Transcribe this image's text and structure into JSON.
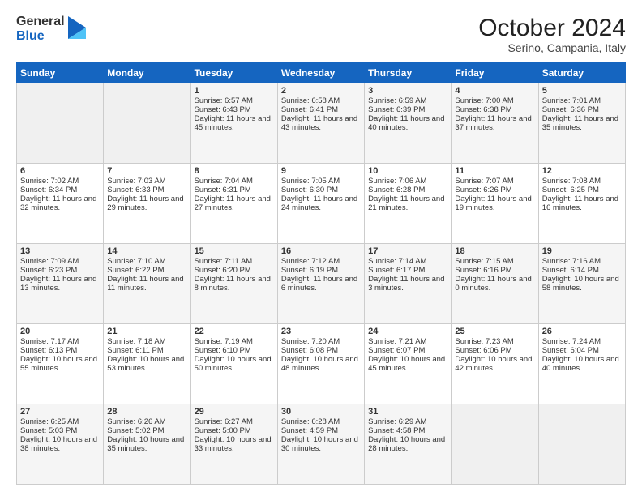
{
  "header": {
    "logo_general": "General",
    "logo_blue": "Blue",
    "title": "October 2024",
    "location": "Serino, Campania, Italy"
  },
  "days_of_week": [
    "Sunday",
    "Monday",
    "Tuesday",
    "Wednesday",
    "Thursday",
    "Friday",
    "Saturday"
  ],
  "weeks": [
    [
      {
        "day": "",
        "info": ""
      },
      {
        "day": "",
        "info": ""
      },
      {
        "day": "1",
        "info": "Sunrise: 6:57 AM\nSunset: 6:43 PM\nDaylight: 11 hours and 45 minutes."
      },
      {
        "day": "2",
        "info": "Sunrise: 6:58 AM\nSunset: 6:41 PM\nDaylight: 11 hours and 43 minutes."
      },
      {
        "day": "3",
        "info": "Sunrise: 6:59 AM\nSunset: 6:39 PM\nDaylight: 11 hours and 40 minutes."
      },
      {
        "day": "4",
        "info": "Sunrise: 7:00 AM\nSunset: 6:38 PM\nDaylight: 11 hours and 37 minutes."
      },
      {
        "day": "5",
        "info": "Sunrise: 7:01 AM\nSunset: 6:36 PM\nDaylight: 11 hours and 35 minutes."
      }
    ],
    [
      {
        "day": "6",
        "info": "Sunrise: 7:02 AM\nSunset: 6:34 PM\nDaylight: 11 hours and 32 minutes."
      },
      {
        "day": "7",
        "info": "Sunrise: 7:03 AM\nSunset: 6:33 PM\nDaylight: 11 hours and 29 minutes."
      },
      {
        "day": "8",
        "info": "Sunrise: 7:04 AM\nSunset: 6:31 PM\nDaylight: 11 hours and 27 minutes."
      },
      {
        "day": "9",
        "info": "Sunrise: 7:05 AM\nSunset: 6:30 PM\nDaylight: 11 hours and 24 minutes."
      },
      {
        "day": "10",
        "info": "Sunrise: 7:06 AM\nSunset: 6:28 PM\nDaylight: 11 hours and 21 minutes."
      },
      {
        "day": "11",
        "info": "Sunrise: 7:07 AM\nSunset: 6:26 PM\nDaylight: 11 hours and 19 minutes."
      },
      {
        "day": "12",
        "info": "Sunrise: 7:08 AM\nSunset: 6:25 PM\nDaylight: 11 hours and 16 minutes."
      }
    ],
    [
      {
        "day": "13",
        "info": "Sunrise: 7:09 AM\nSunset: 6:23 PM\nDaylight: 11 hours and 13 minutes."
      },
      {
        "day": "14",
        "info": "Sunrise: 7:10 AM\nSunset: 6:22 PM\nDaylight: 11 hours and 11 minutes."
      },
      {
        "day": "15",
        "info": "Sunrise: 7:11 AM\nSunset: 6:20 PM\nDaylight: 11 hours and 8 minutes."
      },
      {
        "day": "16",
        "info": "Sunrise: 7:12 AM\nSunset: 6:19 PM\nDaylight: 11 hours and 6 minutes."
      },
      {
        "day": "17",
        "info": "Sunrise: 7:14 AM\nSunset: 6:17 PM\nDaylight: 11 hours and 3 minutes."
      },
      {
        "day": "18",
        "info": "Sunrise: 7:15 AM\nSunset: 6:16 PM\nDaylight: 11 hours and 0 minutes."
      },
      {
        "day": "19",
        "info": "Sunrise: 7:16 AM\nSunset: 6:14 PM\nDaylight: 10 hours and 58 minutes."
      }
    ],
    [
      {
        "day": "20",
        "info": "Sunrise: 7:17 AM\nSunset: 6:13 PM\nDaylight: 10 hours and 55 minutes."
      },
      {
        "day": "21",
        "info": "Sunrise: 7:18 AM\nSunset: 6:11 PM\nDaylight: 10 hours and 53 minutes."
      },
      {
        "day": "22",
        "info": "Sunrise: 7:19 AM\nSunset: 6:10 PM\nDaylight: 10 hours and 50 minutes."
      },
      {
        "day": "23",
        "info": "Sunrise: 7:20 AM\nSunset: 6:08 PM\nDaylight: 10 hours and 48 minutes."
      },
      {
        "day": "24",
        "info": "Sunrise: 7:21 AM\nSunset: 6:07 PM\nDaylight: 10 hours and 45 minutes."
      },
      {
        "day": "25",
        "info": "Sunrise: 7:23 AM\nSunset: 6:06 PM\nDaylight: 10 hours and 42 minutes."
      },
      {
        "day": "26",
        "info": "Sunrise: 7:24 AM\nSunset: 6:04 PM\nDaylight: 10 hours and 40 minutes."
      }
    ],
    [
      {
        "day": "27",
        "info": "Sunrise: 6:25 AM\nSunset: 5:03 PM\nDaylight: 10 hours and 38 minutes."
      },
      {
        "day": "28",
        "info": "Sunrise: 6:26 AM\nSunset: 5:02 PM\nDaylight: 10 hours and 35 minutes."
      },
      {
        "day": "29",
        "info": "Sunrise: 6:27 AM\nSunset: 5:00 PM\nDaylight: 10 hours and 33 minutes."
      },
      {
        "day": "30",
        "info": "Sunrise: 6:28 AM\nSunset: 4:59 PM\nDaylight: 10 hours and 30 minutes."
      },
      {
        "day": "31",
        "info": "Sunrise: 6:29 AM\nSunset: 4:58 PM\nDaylight: 10 hours and 28 minutes."
      },
      {
        "day": "",
        "info": ""
      },
      {
        "day": "",
        "info": ""
      }
    ]
  ]
}
